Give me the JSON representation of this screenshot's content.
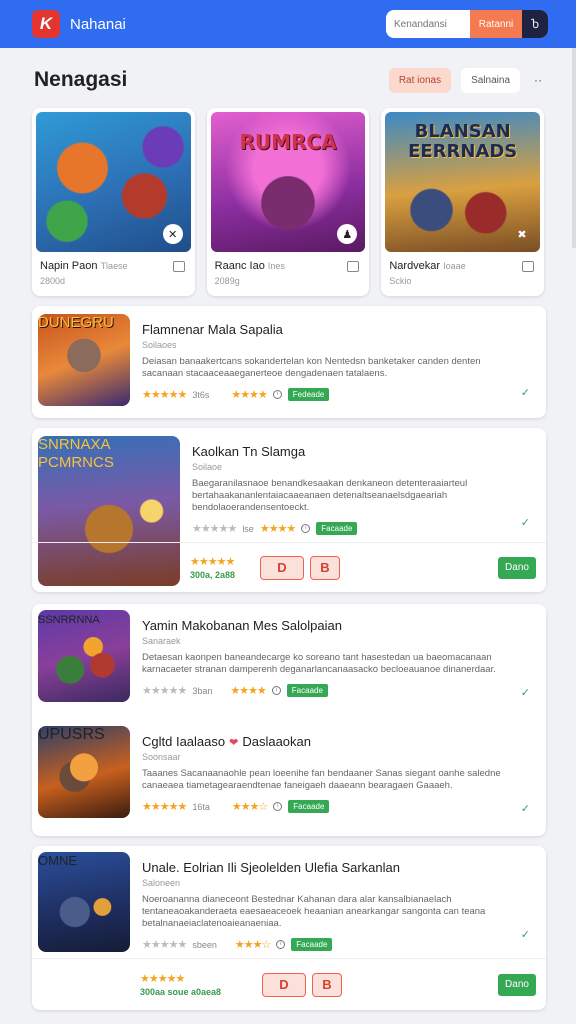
{
  "header": {
    "logo_letter": "K",
    "app_name": "Nahanai",
    "search_placeholder": "Kenandansi",
    "search_button": "Ratanni",
    "dark_button": "Ⴆ"
  },
  "page": {
    "title": "Nenagasi",
    "filter_active": "Rat ionas",
    "filter_plain": "Salnaina",
    "more": "··"
  },
  "tiles": [
    {
      "name": "Napin Paon",
      "tag": "Tlaese",
      "sub": "2800d",
      "art_text": ""
    },
    {
      "name": "Raanc Iao",
      "tag": "Ines",
      "sub": "2089g",
      "art_text": "RUMRCA"
    },
    {
      "name": "Nardvekar",
      "tag": "Ioaae",
      "sub": "Sckio",
      "art_text": "BLANSAN\nEERRNADS"
    }
  ],
  "games": [
    {
      "name": "Flamnenar Mala Sapalia",
      "tag": "Soilaoes",
      "desc": "Deiasan banaakertcans sokandertelan kon Nentedsn banketaker canden denten sacanaan stacaaceaaeganerteoe dengadenaen tatalaens.",
      "rating_text": "3t6s",
      "badge": "Fedeade",
      "art_text": "DUNEGRU"
    },
    {
      "name": "Kaolkan Tn Slamga",
      "tag": "Soilaoe",
      "desc": "Baegaranilasnaoe benandkesaakan denkaneon detenteraaiarteul bertahaakananlentaiacaaeanaen detenaltseanaelsdgaeariah bendolaoerandensentoeckt.",
      "rating_text": "lse",
      "badge": "Facaade",
      "art_text": "SNRNAXA PCMRNCS",
      "foot_price": "300a, 2a88",
      "btn1": "D",
      "btn2": "B",
      "gbtn": "Dano"
    },
    {
      "name": "Yamin Makobanan Mes Salolpaian",
      "tag": "Sanaraek",
      "desc": "Detaesan kaonpen baneandecarge ko soreano tant hasestedan ua baeomacanaan karnacaeter stranan damperenh deganarlancanaasacko becloeauanoe dinanerdaar.",
      "rating_text": "3ban",
      "badge": "Facaade",
      "art_text": "SSNRRNNA"
    },
    {
      "name": "Cgltd Iaalaaso",
      "name2": "Daslaaokan",
      "tag": "Soonsaar",
      "desc": "Taaanes Sacanaanaohle pean loeenihe fan bendaaner Sanas siegant oanhe saledne canaeaea tiametagearaendtenae faneigaeh daaeann bearagaen Gaaaeh.",
      "rating_text": "16ta",
      "badge": "Facaade",
      "art_text": "UPUSRS"
    },
    {
      "name": "Unale. Eolrian Ili Sjeolelden Ulefia Sarkanlan",
      "tag": "Saloneen",
      "desc": "Noeroananna dianeceont Bestednar Kahanan dara alar kansalbianaelach tentaneaoakanderaeta eaesaeaceoek heaanian anearkangar sangonta can teana betalnanaeiaclatenoaieanaeniaa.",
      "rating_text": "sbeen",
      "badge": "Facaade",
      "art_text": "OMNE",
      "foot_price": "300aa soue  a0aea8",
      "btn1": "D",
      "btn2": "B",
      "gbtn": "Dano"
    }
  ],
  "colors": {
    "topbar": "#2f6cf0",
    "accent_orange": "#f57a4f",
    "green": "#35a853",
    "star": "#f4a41e"
  }
}
